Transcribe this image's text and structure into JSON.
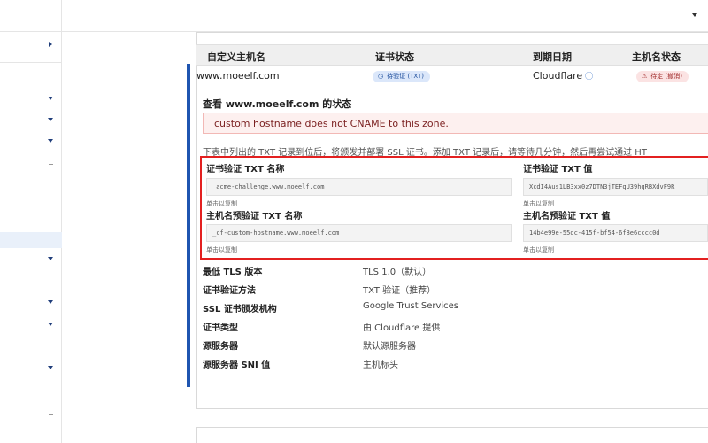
{
  "table": {
    "headers": [
      "自定义主机名",
      "证书状态",
      "到期日期",
      "主机名状态"
    ],
    "row": {
      "hostname": "www.moeelf.com",
      "cert_status": "待验证 (TXT)",
      "issuer": "Cloudflare",
      "host_status": "待定 (撤消)"
    }
  },
  "panel": {
    "title": "查看 www.moeelf.com 的状态",
    "alert": "custom hostname does not CNAME to this zone.",
    "description": "下表中列出的 TXT 记录到位后，将颁发并部署 SSL 证书。添加 TXT 记录后，请等待几分钟，然后再尝试通过 HT",
    "fields": [
      {
        "label": "证书验证 TXT 名称",
        "value": "_acme-challenge.www.moeelf.com",
        "hint": "单击以复制"
      },
      {
        "label": "证书验证 TXT 值",
        "value": "XcdI4Aus1LB3xx0z7DTN3jTEFqU39hqRBXdvF9R",
        "hint": "单击以复制"
      },
      {
        "label": "主机名预验证 TXT 名称",
        "value": "_cf-custom-hostname.www.moeelf.com",
        "hint": "单击以复制"
      },
      {
        "label": "主机名预验证 TXT 值",
        "value": "14b4e99e-55dc-415f-bf54-6f8e6cccc0d",
        "hint": "单击以复制"
      }
    ],
    "details": [
      {
        "label": "最低 TLS 版本",
        "value": "TLS 1.0（默认）"
      },
      {
        "label": "证书验证方法",
        "value": "TXT 验证（推荐）"
      },
      {
        "label": "SSL 证书颁发机构",
        "value": "Google Trust Services"
      },
      {
        "label": "证书类型",
        "value": "由 Cloudflare 提供"
      },
      {
        "label": "源服务器",
        "value": "默认源服务器"
      },
      {
        "label": "源服务器 SNI 值",
        "value": "主机标头"
      }
    ]
  },
  "icons": {
    "pending": "clock-icon",
    "warning": "warning-icon",
    "info": "info-icon"
  },
  "colors": {
    "accent": "#1f55b0",
    "highlight_border": "#e32020",
    "alert_bg": "#fdf0ef"
  }
}
